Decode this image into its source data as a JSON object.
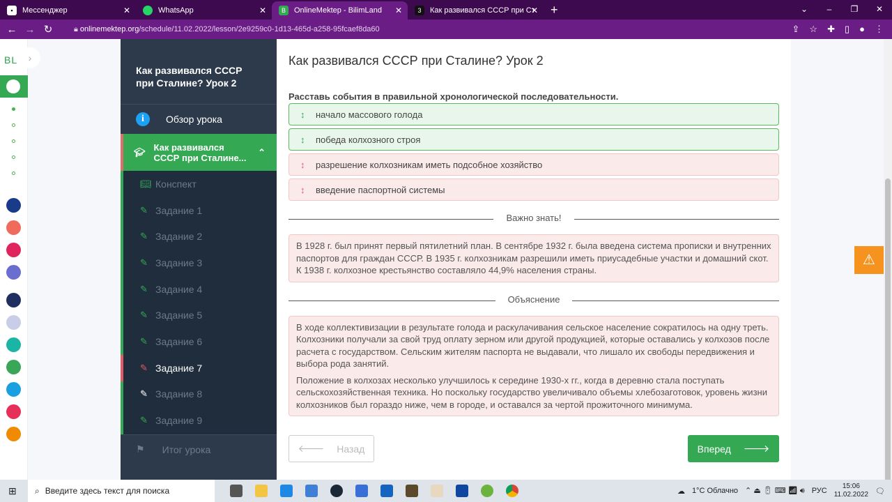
{
  "browser": {
    "tabs": [
      {
        "title": "Мессенджер",
        "icon": "messenger-icon"
      },
      {
        "title": "WhatsApp",
        "icon": "whatsapp-icon"
      },
      {
        "title": "OnlineMektep - BilimLand",
        "icon": "bilimland-icon",
        "active": true
      },
      {
        "title": "Как развивался СССР при Стали",
        "icon": "z-icon"
      }
    ],
    "url_domain": "onlinemektep.org",
    "url_path": "/schedule/11.02.2022/lesson/2e9259c0-1d13-465d-a258-95fcaef8da60"
  },
  "rail": {
    "logo": "BL"
  },
  "sidebar": {
    "lesson_title": "Как развивался СССР при Сталине? Урок 2",
    "overview": "Обзор урока",
    "current_section": "Как развивался СССР при Сталине...",
    "items": [
      {
        "label": "Конспект",
        "icon": "book-icon"
      },
      {
        "label": "Задание 1"
      },
      {
        "label": "Задание 2"
      },
      {
        "label": "Задание 3"
      },
      {
        "label": "Задание 4"
      },
      {
        "label": "Задание 5"
      },
      {
        "label": "Задание 6"
      },
      {
        "label": "Задание 7"
      },
      {
        "label": "Задание 8"
      },
      {
        "label": "Задание 9"
      }
    ],
    "summary": "Итог урока"
  },
  "main": {
    "title": "Как развивался СССР при Сталине? Урок 2",
    "question": "Расставь события в правильной хронологической последовательности.",
    "answers": [
      {
        "text": "начало массового голода",
        "status": "correct"
      },
      {
        "text": "победа колхозного строя",
        "status": "correct"
      },
      {
        "text": "разрешение колхозникам иметь подсобное хозяйство",
        "status": "wrong"
      },
      {
        "text": "введение паспортной системы",
        "status": "wrong"
      }
    ],
    "important_label": "Важно знать!",
    "important_text": "В 1928 г. был принят первый пятилетний план. В сентябре 1932 г. была введена система прописки и внутренних паспортов для граждан СССР. В 1935 г. колхозникам разрешили иметь приусадебные участки и домашний скот. К 1938 г. колхозное крестьянство составляло 44,9% населения страны.",
    "explanation_label": "Объяснение",
    "explanation_p1": "В ходе коллективизации в результате голода и раскулачивания сельское население сократилось на одну треть. Колхозники получали за свой труд оплату зерном или другой продукцией, которые оставались у колхозов после расчета с государством. Сельским жителям паспорта не выдавали, что лишало их свободы передвижения и выбора рода занятий.",
    "explanation_p2": "Положение в колхозах несколько улучшилось к середине 1930-х гг., когда в деревню стала поступать сельскохозяйственная техника. Но поскольку государство увеличивало объемы хлебозаготовок, уровень жизни колхозников был гораздо ниже, чем в городе, и оставался за чертой прожиточного минимума.",
    "back": "Назад",
    "next": "Вперед"
  },
  "taskbar": {
    "search_placeholder": "Введите здесь текст для поиска",
    "weather": "1°C Облачно",
    "lang": "РУС",
    "time": "15:06",
    "date": "11.02.2022"
  }
}
